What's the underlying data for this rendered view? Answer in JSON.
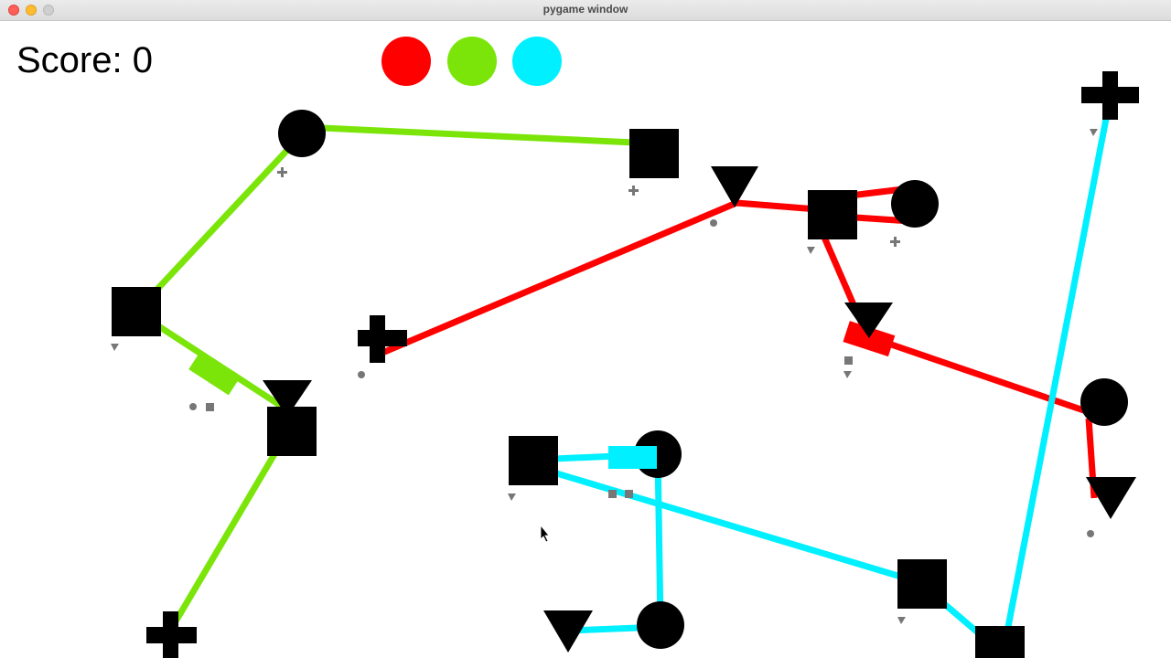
{
  "window": {
    "title": "pygame window"
  },
  "hud": {
    "score_label": "Score: 0"
  },
  "lines": [
    {
      "name": "red-line",
      "color": "#ff0000"
    },
    {
      "name": "green-line",
      "color": "#7be50a"
    },
    {
      "name": "cyan-line",
      "color": "#00f0ff"
    }
  ],
  "colors": {
    "red": "#ff0000",
    "green": "#7be50a",
    "cyan": "#00f0ff",
    "station": "#000000",
    "passenger": "#777777"
  }
}
